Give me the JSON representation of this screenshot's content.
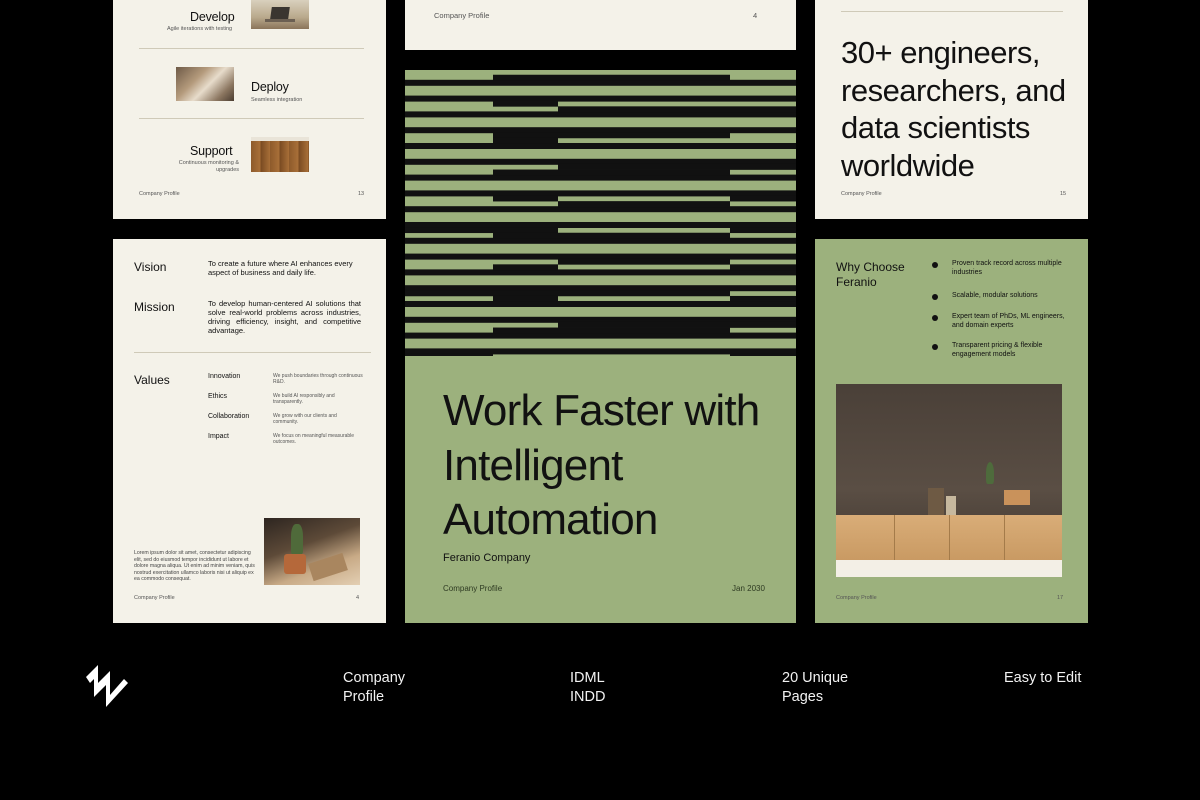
{
  "colors": {
    "background": "#000000",
    "paper": "#f4f2e9",
    "accent_green": "#9cb17d",
    "stripe_dark": "#111111"
  },
  "page13": {
    "services": [
      {
        "title": "Develop",
        "desc": "Agile iterations with testing"
      },
      {
        "title": "Deploy",
        "desc": "Seamless integration"
      },
      {
        "title": "Support",
        "desc": "Continuous monitoring & upgrades"
      }
    ],
    "footer": "Company Profile",
    "page_number": "13"
  },
  "page4top": {
    "footer": "Company Profile",
    "page_number": "4"
  },
  "page15": {
    "statement": "30+ engineers, researchers, and data scientists worldwide",
    "footer": "Company Profile",
    "page_number": "15"
  },
  "page4": {
    "vision_label": "Vision",
    "vision_text": "To create a future where AI enhances every aspect of business and daily life.",
    "mission_label": "Mission",
    "mission_text": "To develop human-centered AI solutions that solve real-world problems across industries, driving efficiency, insight, and competitive advantage.",
    "values_label": "Values",
    "values": [
      {
        "name": "Innovation",
        "desc": "We push boundaries through continuous R&D."
      },
      {
        "name": "Ethics",
        "desc": "We build AI responsibly and transparently."
      },
      {
        "name": "Collaboration",
        "desc": "We grow with our clients and community."
      },
      {
        "name": "Impact",
        "desc": "We focus on meaningful measurable outcomes."
      }
    ],
    "lorem": "Lorem ipsum dolor sit amet, consectetur adipiscing elit, sed do eiusmod tempor incididunt ut labore et dolore magna aliqua. Ut enim ad minim veniam, quis nostrud exercitation ullamco laboris nisi ut aliquip ex ea commodo consequat.",
    "footer": "Company Profile",
    "page_number": "4"
  },
  "cover": {
    "title": "Work Faster with Intelligent Automation",
    "company": "Feranio Company",
    "footer": "Company Profile",
    "date": "Jan 2030"
  },
  "page17": {
    "heading": "Why Choose Feranio",
    "bullets": [
      "Proven track record across multiple industries",
      "Scalable, modular solutions",
      "Expert team of PhDs, ML engineers, and domain experts",
      "Transparent pricing & flexible engagement models"
    ],
    "footer": "Company Profile",
    "page_number": "17"
  },
  "bottom_bar": {
    "logo_icon": "zigzag-logo-icon",
    "features": [
      {
        "line1": "Company",
        "line2": "Profile"
      },
      {
        "line1": "IDML",
        "line2": "INDD"
      },
      {
        "line1": "20 Unique",
        "line2": "Pages"
      },
      {
        "line1": "Easy to Edit",
        "line2": ""
      }
    ]
  }
}
